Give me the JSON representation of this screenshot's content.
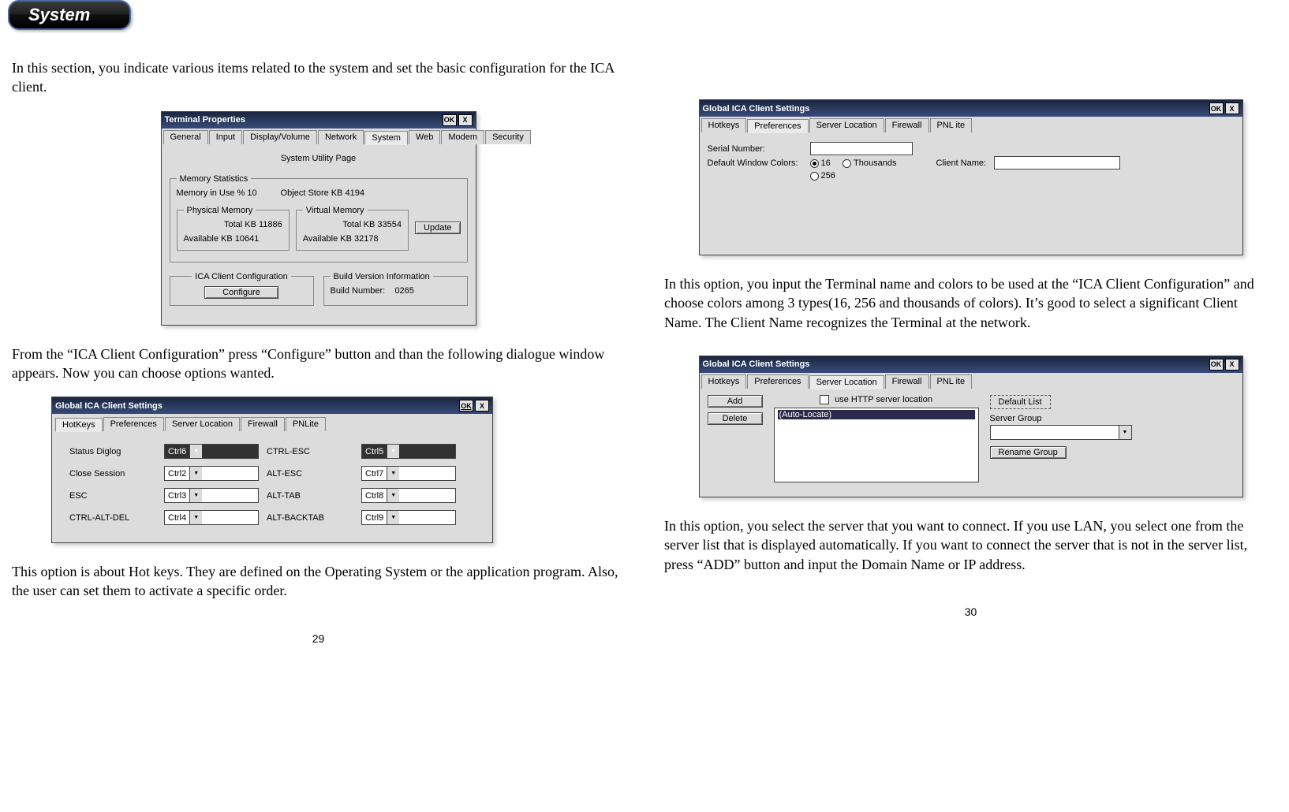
{
  "heading": "System",
  "left": {
    "intro": "In this section, you indicate various items related to the system and set the basic configuration for the ICA client.",
    "para2": "From the “ICA Client Configuration” press “Configure” button and than the following dialogue window appears. Now you can choose options wanted.",
    "para3": "This option is about Hot keys. They are defined on the Operating System or the application program. Also, the user can set them to activate a specific order.",
    "page_num": "29"
  },
  "right": {
    "para1": "In this option, you input the Terminal name and colors to be used at the “ICA Client Configuration” and choose colors  among 3 types(16, 256 and thousands of colors). It’s good to select a significant Client Name. The Client Name recognizes the Terminal at the network.",
    "para2": "In this option, you select the server that you want to connect. If you use LAN, you select one from the server list that is displayed automatically. If you want to connect the server that is not in the server list, press “ADD” button and input the Domain Name or IP address.",
    "page_num": "30"
  },
  "win_terminal": {
    "title": "Terminal Properties",
    "ok": "OK",
    "close": "X",
    "tabs": [
      "General",
      "Input",
      "Display/Volume",
      "Network",
      "System",
      "Web",
      "Modem",
      "Security"
    ],
    "body_title": "System Utility Page",
    "mem_stats": {
      "legend": "Memory Statistics",
      "mem_in_use": "Memory in Use %  10",
      "object_store": "Object Store KB  4194",
      "phys_legend": "Physical Memory",
      "phys_total": "Total KB 11886",
      "phys_avail": "Available KB 10641",
      "virt_legend": "Virtual Memory",
      "virt_total": "Total KB 33554",
      "virt_avail": "Available KB 32178",
      "update": "Update"
    },
    "ica_conf": {
      "legend": "ICA Client Configuration",
      "configure": "Configure"
    },
    "build": {
      "legend": "Build Version Information",
      "label": "Build Number:",
      "value": "0265"
    }
  },
  "win_hotkeys": {
    "title": "Global ICA Client Settings",
    "ok": "OK",
    "close": "X",
    "tabs": [
      "HotKeys",
      "Preferences",
      "Server Location",
      "Firewall",
      "PNLite"
    ],
    "rows": [
      {
        "l": "Status Diglog",
        "lv": "Ctrl6",
        "r": "CTRL-ESC",
        "rv": "Ctrl5"
      },
      {
        "l": "Close Session",
        "lv": "Ctrl2",
        "r": "ALT-ESC",
        "rv": "Ctrl7"
      },
      {
        "l": "ESC",
        "lv": "Ctrl3",
        "r": "ALT-TAB",
        "rv": "Ctrl8"
      },
      {
        "l": "CTRL-ALT-DEL",
        "lv": "Ctrl4",
        "r": "ALT-BACKTAB",
        "rv": "Ctrl9"
      }
    ]
  },
  "win_prefs": {
    "title": "Global ICA Client Settings",
    "ok": "OK",
    "close": "X",
    "tabs": [
      "Hotkeys",
      "Preferences",
      "Server Location",
      "Firewall",
      "PNL ite"
    ],
    "serial": "Serial Number:",
    "colors_label": "Default Window Colors:",
    "c16": "16",
    "c256": "256",
    "cthousands": "Thousands",
    "client_name": "Client Name:"
  },
  "win_server": {
    "title": "Global ICA Client Settings",
    "ok": "OK",
    "close": "X",
    "tabs": [
      "Hotkeys",
      "Preferences",
      "Server Location",
      "Firewall",
      "PNL ite"
    ],
    "use_http": "use HTTP server location",
    "add": "Add",
    "delete": "Delete",
    "list_item": "(Auto-Locate)",
    "default_list": "Default List",
    "server_group": "Server Group",
    "rename": "Rename Group"
  }
}
